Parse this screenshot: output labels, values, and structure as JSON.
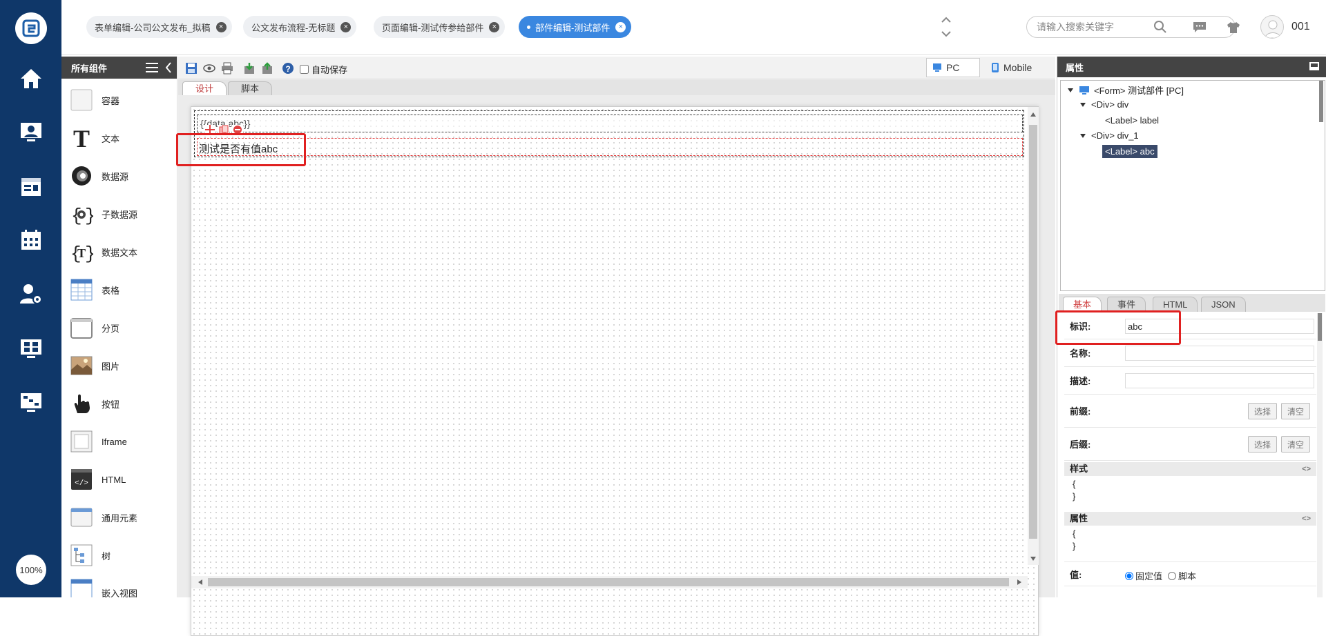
{
  "app": {
    "zoom": "100%",
    "user": "001"
  },
  "tabs": [
    {
      "label": "表单编辑-公司公文发布_拟稿"
    },
    {
      "label": "公文发布流程-无标题"
    },
    {
      "label": "页面编辑-测试传参给部件"
    },
    {
      "label": "部件编辑-测试部件",
      "active": true
    }
  ],
  "search": {
    "placeholder": "请输入搜索关键字"
  },
  "left_panel": {
    "title": "所有组件",
    "items": [
      "容器",
      "文本",
      "数据源",
      "子数据源",
      "数据文本",
      "表格",
      "分页",
      "图片",
      "按钮",
      "Iframe",
      "HTML",
      "通用元素",
      "树",
      "嵌入视图"
    ]
  },
  "toolbar": {
    "autosave_label": "自动保存",
    "pc_label": "PC",
    "mobile_label": "Mobile"
  },
  "designer_tabs": [
    "设计",
    "脚本"
  ],
  "canvas": {
    "row1_text": "{{data.abc}}",
    "row2_text": "测试是否有值abc"
  },
  "props": {
    "title": "属性",
    "tree": [
      "<Form> 测试部件 [PC]",
      "<Div> div",
      "<Label> label",
      "<Div> div_1",
      "<Label> abc"
    ],
    "tabs": [
      "基本",
      "事件",
      "HTML",
      "JSON"
    ],
    "fields": {
      "id_label": "标识:",
      "id_value": "abc",
      "name_label": "名称:",
      "desc_label": "描述:",
      "prefix_label": "前缀:",
      "suffix_label": "后缀:",
      "select_label": "选择",
      "clear_label": "清空"
    },
    "style_label": "样式",
    "attr_label": "属性",
    "brace_open": "{",
    "brace_close": "}",
    "value_label": "值:",
    "fixed_label": "固定值",
    "script_label": "脚本"
  }
}
